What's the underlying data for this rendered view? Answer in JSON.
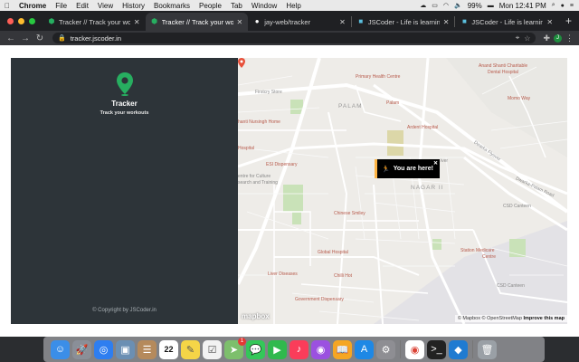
{
  "menubar": {
    "apple": "",
    "items": [
      "Chrome",
      "File",
      "Edit",
      "View",
      "History",
      "Bookmarks",
      "People",
      "Tab",
      "Window",
      "Help"
    ],
    "battery": "99%",
    "clock": "Mon 12:41 PM"
  },
  "tabs": [
    {
      "label": "Tracker // Track your workouts",
      "icon": "map-pin-icon",
      "active": false
    },
    {
      "label": "Tracker // Track your workouts",
      "icon": "map-pin-icon",
      "active": true
    },
    {
      "label": "jay-web/tracker",
      "icon": "github-icon",
      "active": false
    },
    {
      "label": "JSCoder - Life is learning",
      "icon": "jscoder-icon",
      "active": false
    },
    {
      "label": "JSCoder - Life is learning",
      "icon": "jscoder-icon",
      "active": false
    }
  ],
  "toolbar": {
    "url": "tracker.jscoder.in",
    "profile_initial": "J"
  },
  "sidebar": {
    "title": "Tracker",
    "subtitle": "Track your workouts",
    "copyright": "© Copyright by JSCoder.in",
    "accent": "#27ae60"
  },
  "map": {
    "popup_text": "You are here!",
    "popup_icon": "runner-icon",
    "labels": {
      "primary_health_centre": "Primary Health Centre",
      "anand_shanti": "Anand Shanti Charitable",
      "dental_hospital": "Dental Hospital",
      "firstcry": "Firstcry Store",
      "palam_big": "PALAM",
      "palam_station": "Palam",
      "momo_way": "Momo Way",
      "nursing_home": "hanti Nursingh Home",
      "ardent_hospital": "Ardent Hospital",
      "dwarka_flyover": "Dwarka Flyover",
      "hospital": "Hospital",
      "esi_dispensary": "ESI Dispensary",
      "culture_centre": "entre for Culture",
      "research": "search and Training",
      "river": "iver",
      "dwarka_palam_road": "Dwarka-Palam Road",
      "nagar": "NAGAR II",
      "chinese_smiley": "Chinese Smiley",
      "csd_canteen_1": "CSD Canteen",
      "global_hospital": "Global Hospital",
      "station_medicare": "Station Medicare",
      "centre": "Centre",
      "liver_diseases": "Liver Diseases",
      "chilli_hot": "Chilli Hot",
      "csd_canteen_2": "CSD Canteen",
      "govt_dispensary": "Government Dispensary"
    },
    "mapbox_logo": "mapbox",
    "attrib_mapbox": "© Mapbox",
    "attrib_osm": "© OpenStreetMap",
    "attrib_improve": "Improve this map"
  },
  "dock": {
    "icons": [
      "finder-icon",
      "launchpad-icon",
      "safari-icon",
      "photos-preview-icon",
      "contacts-icon",
      "calendar-icon",
      "notes-icon",
      "reminders-icon",
      "maps-icon",
      "messages-icon",
      "facetime-icon",
      "music-icon",
      "podcasts-icon",
      "books-icon",
      "app-store-icon",
      "system-preferences-icon",
      "chrome-icon",
      "terminal-icon",
      "vscode-icon",
      "trash-icon"
    ],
    "calendar_day": "22",
    "badge_count": "1"
  }
}
